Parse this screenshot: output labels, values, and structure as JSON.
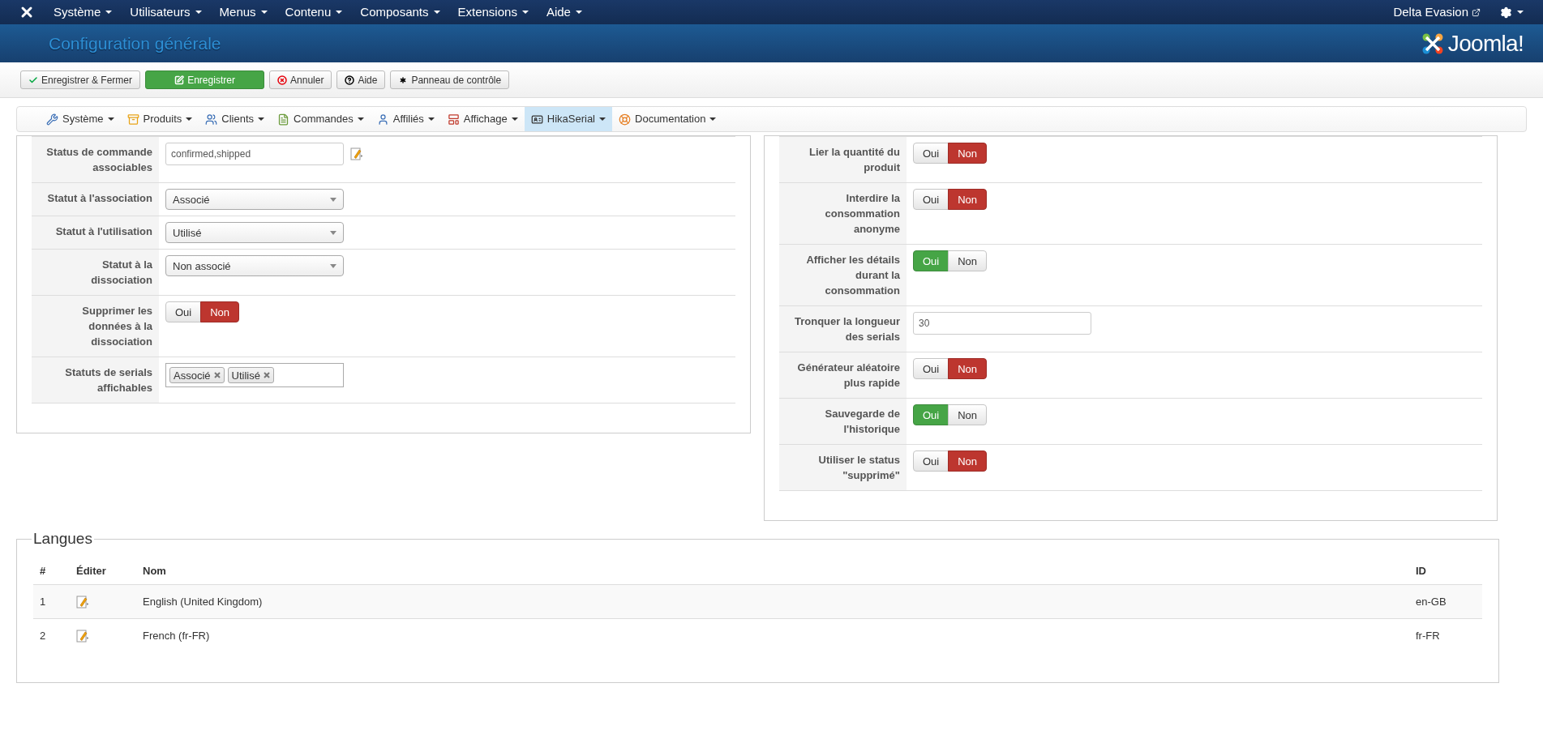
{
  "top_menu": [
    "Système",
    "Utilisateurs",
    "Menus",
    "Contenu",
    "Composants",
    "Extensions",
    "Aide"
  ],
  "top_right": {
    "site": "Delta Evasion"
  },
  "header": {
    "title": "Configuration générale",
    "logo_text": "Joomla!"
  },
  "toolbar": [
    {
      "label": "Enregistrer & Fermer",
      "kind": "save-close"
    },
    {
      "label": "Enregistrer",
      "kind": "save"
    },
    {
      "label": "Annuler",
      "kind": "cancel"
    },
    {
      "label": "Aide",
      "kind": "help"
    },
    {
      "label": "Panneau de contrôle",
      "kind": "dashboard"
    }
  ],
  "submenu": [
    {
      "label": "Système",
      "kind": "system",
      "selected": false
    },
    {
      "label": "Produits",
      "kind": "products",
      "selected": false
    },
    {
      "label": "Clients",
      "kind": "customers",
      "selected": false
    },
    {
      "label": "Commandes",
      "kind": "orders",
      "selected": false
    },
    {
      "label": "Affiliés",
      "kind": "affiliates",
      "selected": false
    },
    {
      "label": "Affichage",
      "kind": "display",
      "selected": false
    },
    {
      "label": "HikaSerial",
      "kind": "serial",
      "selected": true
    },
    {
      "label": "Documentation",
      "kind": "docs",
      "selected": false
    }
  ],
  "left_settings": [
    {
      "label": "Status de commande associables",
      "kind": "text",
      "value": "confirmed,shipped",
      "editable": true
    },
    {
      "label": "Statut à l'association",
      "kind": "select",
      "value": "Associé"
    },
    {
      "label": "Statut à l'utilisation",
      "kind": "select",
      "value": "Utilisé"
    },
    {
      "label": "Statut à la dissociation",
      "kind": "select",
      "value": "Non associé"
    },
    {
      "label": "Supprimer les données à la dissociation",
      "kind": "toggle",
      "options": [
        {
          "label": "Oui",
          "selected": false
        },
        {
          "label": "Non",
          "selected": true
        }
      ]
    },
    {
      "label": "Statuts de serials affichables",
      "kind": "tags",
      "tags": [
        "Associé",
        "Utilisé"
      ]
    }
  ],
  "right_settings": [
    {
      "label": "Lier la quantité du produit",
      "kind": "toggle",
      "options": [
        {
          "label": "Oui",
          "selected": false
        },
        {
          "label": "Non",
          "selected": true
        }
      ]
    },
    {
      "label": "Interdire la consommation anonyme",
      "kind": "toggle",
      "options": [
        {
          "label": "Oui",
          "selected": false
        },
        {
          "label": "Non",
          "selected": true
        }
      ]
    },
    {
      "label": "Afficher les détails durant la consommation",
      "kind": "toggle",
      "options": [
        {
          "label": "Oui",
          "selected": true
        },
        {
          "label": "Non",
          "selected": false
        }
      ]
    },
    {
      "label": "Tronquer la longueur des serials",
      "kind": "text",
      "value": "30",
      "editable": false
    },
    {
      "label": "Générateur aléatoire plus rapide",
      "kind": "toggle",
      "options": [
        {
          "label": "Oui",
          "selected": false
        },
        {
          "label": "Non",
          "selected": true
        }
      ]
    },
    {
      "label": "Sauvegarde de l'historique",
      "kind": "toggle",
      "options": [
        {
          "label": "Oui",
          "selected": true
        },
        {
          "label": "Non",
          "selected": false
        }
      ]
    },
    {
      "label": "Utiliser le status \"supprimé\"",
      "kind": "toggle",
      "options": [
        {
          "label": "Oui",
          "selected": false
        },
        {
          "label": "Non",
          "selected": true
        }
      ]
    }
  ],
  "languages": {
    "legend": "Langues",
    "columns": [
      "#",
      "Éditer",
      "Nom",
      "ID"
    ],
    "rows": [
      {
        "num": "1",
        "name": "English (United Kingdom)",
        "id": "en-GB"
      },
      {
        "num": "2",
        "name": "French (fr-FR)",
        "id": "fr-FR"
      }
    ]
  }
}
